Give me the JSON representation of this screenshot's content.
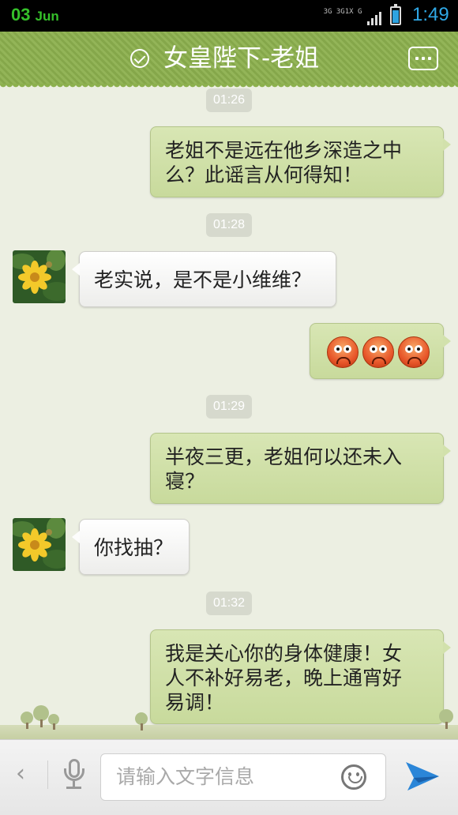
{
  "status_bar": {
    "day": "03",
    "month": "Jun",
    "network_top": "3G 3G1X G",
    "time": "1:49"
  },
  "header": {
    "title": "女皇陛下-老姐"
  },
  "messages": [
    {
      "type": "time",
      "text": "01:26"
    },
    {
      "type": "outgoing",
      "lines": [
        "老姐不是远在他乡深造之中",
        "么？此谣言从何得知！"
      ]
    },
    {
      "type": "time",
      "text": "01:28"
    },
    {
      "type": "incoming",
      "lines": [
        "老实说，是不是小维维？"
      ],
      "avatar": "yellow-flower"
    },
    {
      "type": "outgoing",
      "emoji": [
        "angry-face",
        "angry-face",
        "angry-face"
      ]
    },
    {
      "type": "time",
      "text": "01:29"
    },
    {
      "type": "outgoing",
      "lines": [
        "半夜三更，老姐何以还未入",
        "寝？"
      ]
    },
    {
      "type": "incoming",
      "lines": [
        "你找抽？"
      ],
      "avatar": "yellow-flower"
    },
    {
      "type": "time",
      "text": "01:32"
    },
    {
      "type": "outgoing",
      "lines": [
        "我是关心你的身体健康！女",
        "人不补好易老，晚上通宵好",
        "易调！"
      ]
    }
  ],
  "input_bar": {
    "placeholder": "请输入文字信息"
  },
  "colors": {
    "title_bar": "#8cb04e",
    "outgoing_bubble": "#d2e1ac",
    "incoming_bubble": "#ffffff",
    "chat_background": "#ecefe2",
    "send": "#2b86d8"
  }
}
